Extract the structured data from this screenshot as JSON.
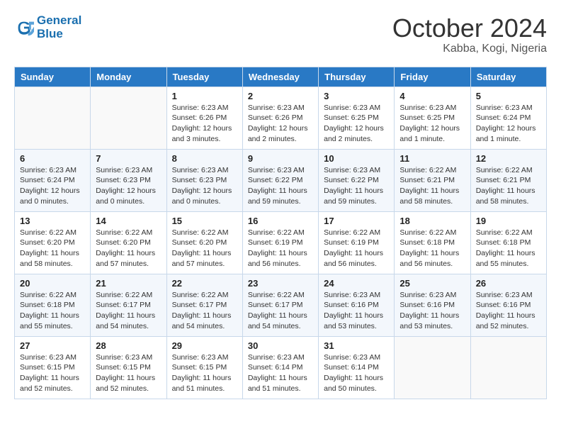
{
  "header": {
    "logo_line1": "General",
    "logo_line2": "Blue",
    "month_title": "October 2024",
    "location": "Kabba, Kogi, Nigeria"
  },
  "days_of_week": [
    "Sunday",
    "Monday",
    "Tuesday",
    "Wednesday",
    "Thursday",
    "Friday",
    "Saturday"
  ],
  "weeks": [
    [
      {
        "day": "",
        "content": ""
      },
      {
        "day": "",
        "content": ""
      },
      {
        "day": "1",
        "content": "Sunrise: 6:23 AM\nSunset: 6:26 PM\nDaylight: 12 hours and 3 minutes."
      },
      {
        "day": "2",
        "content": "Sunrise: 6:23 AM\nSunset: 6:26 PM\nDaylight: 12 hours and 2 minutes."
      },
      {
        "day": "3",
        "content": "Sunrise: 6:23 AM\nSunset: 6:25 PM\nDaylight: 12 hours and 2 minutes."
      },
      {
        "day": "4",
        "content": "Sunrise: 6:23 AM\nSunset: 6:25 PM\nDaylight: 12 hours and 1 minute."
      },
      {
        "day": "5",
        "content": "Sunrise: 6:23 AM\nSunset: 6:24 PM\nDaylight: 12 hours and 1 minute."
      }
    ],
    [
      {
        "day": "6",
        "content": "Sunrise: 6:23 AM\nSunset: 6:24 PM\nDaylight: 12 hours and 0 minutes."
      },
      {
        "day": "7",
        "content": "Sunrise: 6:23 AM\nSunset: 6:23 PM\nDaylight: 12 hours and 0 minutes."
      },
      {
        "day": "8",
        "content": "Sunrise: 6:23 AM\nSunset: 6:23 PM\nDaylight: 12 hours and 0 minutes."
      },
      {
        "day": "9",
        "content": "Sunrise: 6:23 AM\nSunset: 6:22 PM\nDaylight: 11 hours and 59 minutes."
      },
      {
        "day": "10",
        "content": "Sunrise: 6:23 AM\nSunset: 6:22 PM\nDaylight: 11 hours and 59 minutes."
      },
      {
        "day": "11",
        "content": "Sunrise: 6:22 AM\nSunset: 6:21 PM\nDaylight: 11 hours and 58 minutes."
      },
      {
        "day": "12",
        "content": "Sunrise: 6:22 AM\nSunset: 6:21 PM\nDaylight: 11 hours and 58 minutes."
      }
    ],
    [
      {
        "day": "13",
        "content": "Sunrise: 6:22 AM\nSunset: 6:20 PM\nDaylight: 11 hours and 58 minutes."
      },
      {
        "day": "14",
        "content": "Sunrise: 6:22 AM\nSunset: 6:20 PM\nDaylight: 11 hours and 57 minutes."
      },
      {
        "day": "15",
        "content": "Sunrise: 6:22 AM\nSunset: 6:20 PM\nDaylight: 11 hours and 57 minutes."
      },
      {
        "day": "16",
        "content": "Sunrise: 6:22 AM\nSunset: 6:19 PM\nDaylight: 11 hours and 56 minutes."
      },
      {
        "day": "17",
        "content": "Sunrise: 6:22 AM\nSunset: 6:19 PM\nDaylight: 11 hours and 56 minutes."
      },
      {
        "day": "18",
        "content": "Sunrise: 6:22 AM\nSunset: 6:18 PM\nDaylight: 11 hours and 56 minutes."
      },
      {
        "day": "19",
        "content": "Sunrise: 6:22 AM\nSunset: 6:18 PM\nDaylight: 11 hours and 55 minutes."
      }
    ],
    [
      {
        "day": "20",
        "content": "Sunrise: 6:22 AM\nSunset: 6:18 PM\nDaylight: 11 hours and 55 minutes."
      },
      {
        "day": "21",
        "content": "Sunrise: 6:22 AM\nSunset: 6:17 PM\nDaylight: 11 hours and 54 minutes."
      },
      {
        "day": "22",
        "content": "Sunrise: 6:22 AM\nSunset: 6:17 PM\nDaylight: 11 hours and 54 minutes."
      },
      {
        "day": "23",
        "content": "Sunrise: 6:22 AM\nSunset: 6:17 PM\nDaylight: 11 hours and 54 minutes."
      },
      {
        "day": "24",
        "content": "Sunrise: 6:23 AM\nSunset: 6:16 PM\nDaylight: 11 hours and 53 minutes."
      },
      {
        "day": "25",
        "content": "Sunrise: 6:23 AM\nSunset: 6:16 PM\nDaylight: 11 hours and 53 minutes."
      },
      {
        "day": "26",
        "content": "Sunrise: 6:23 AM\nSunset: 6:16 PM\nDaylight: 11 hours and 52 minutes."
      }
    ],
    [
      {
        "day": "27",
        "content": "Sunrise: 6:23 AM\nSunset: 6:15 PM\nDaylight: 11 hours and 52 minutes."
      },
      {
        "day": "28",
        "content": "Sunrise: 6:23 AM\nSunset: 6:15 PM\nDaylight: 11 hours and 52 minutes."
      },
      {
        "day": "29",
        "content": "Sunrise: 6:23 AM\nSunset: 6:15 PM\nDaylight: 11 hours and 51 minutes."
      },
      {
        "day": "30",
        "content": "Sunrise: 6:23 AM\nSunset: 6:14 PM\nDaylight: 11 hours and 51 minutes."
      },
      {
        "day": "31",
        "content": "Sunrise: 6:23 AM\nSunset: 6:14 PM\nDaylight: 11 hours and 50 minutes."
      },
      {
        "day": "",
        "content": ""
      },
      {
        "day": "",
        "content": ""
      }
    ]
  ]
}
